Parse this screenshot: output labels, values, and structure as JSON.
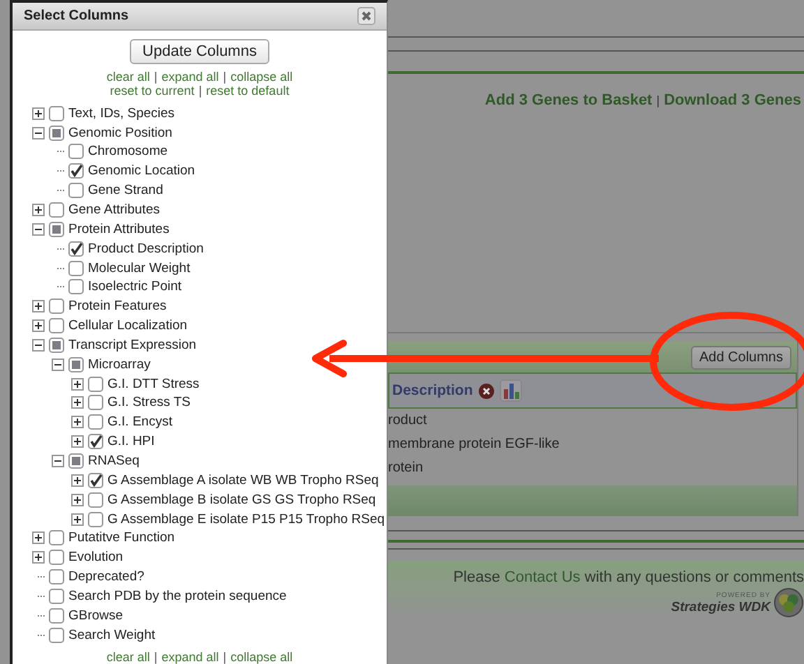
{
  "dialog": {
    "title": "Select Columns",
    "update_button": "Update Columns",
    "top_links": [
      [
        {
          "kind": "link",
          "text": "clear all"
        },
        {
          "kind": "sep",
          "text": "|"
        },
        {
          "kind": "link",
          "text": "expand all"
        },
        {
          "kind": "sep",
          "text": "|"
        },
        {
          "kind": "link",
          "text": "collapse all"
        }
      ],
      [
        {
          "kind": "link",
          "text": "reset to current"
        },
        {
          "kind": "sep",
          "text": "|"
        },
        {
          "kind": "link",
          "text": "reset to default"
        }
      ]
    ],
    "tree": [
      {
        "label": "Text, IDs, Species",
        "checked": false,
        "partial": false,
        "expanded": false
      },
      {
        "label": "Genomic Position",
        "checked": false,
        "partial": true,
        "expanded": true,
        "children": [
          {
            "label": "Chromosome",
            "checked": false,
            "partial": false
          },
          {
            "label": "Genomic Location",
            "checked": true,
            "partial": false
          },
          {
            "label": "Gene Strand",
            "checked": false,
            "partial": false
          }
        ]
      },
      {
        "label": "Gene Attributes",
        "checked": false,
        "partial": false,
        "expanded": false
      },
      {
        "label": "Protein Attributes",
        "checked": false,
        "partial": true,
        "expanded": true,
        "children": [
          {
            "label": "Product Description",
            "checked": true,
            "partial": false
          },
          {
            "label": "Molecular Weight",
            "checked": false,
            "partial": false
          },
          {
            "label": "Isoelectric Point",
            "checked": false,
            "partial": false
          }
        ]
      },
      {
        "label": "Protein Features",
        "checked": false,
        "partial": false,
        "expanded": false
      },
      {
        "label": "Cellular Localization",
        "checked": false,
        "partial": false,
        "expanded": false
      },
      {
        "label": "Transcript Expression",
        "checked": false,
        "partial": true,
        "expanded": true,
        "children": [
          {
            "label": "Microarray",
            "checked": false,
            "partial": true,
            "expanded": true,
            "children": [
              {
                "label": "G.I. DTT Stress",
                "checked": false,
                "partial": false,
                "expanded": false
              },
              {
                "label": "G.I. Stress TS",
                "checked": false,
                "partial": false,
                "expanded": false
              },
              {
                "label": "G.I. Encyst",
                "checked": false,
                "partial": false,
                "expanded": false
              },
              {
                "label": "G.I. HPI",
                "checked": true,
                "partial": false,
                "expanded": false
              }
            ]
          },
          {
            "label": "RNASeq",
            "checked": false,
            "partial": true,
            "expanded": true,
            "children": [
              {
                "label": "G Assemblage A isolate WB WB Tropho RSeq",
                "checked": true,
                "partial": false,
                "expanded": false
              },
              {
                "label": "G Assemblage B isolate GS GS Tropho RSeq",
                "checked": false,
                "partial": false,
                "expanded": false
              },
              {
                "label": "G Assemblage E isolate P15 P15 Tropho RSeq",
                "checked": false,
                "partial": false,
                "expanded": false
              }
            ]
          }
        ]
      },
      {
        "label": "Putatitve Function",
        "checked": false,
        "partial": false,
        "expanded": false
      },
      {
        "label": "Evolution",
        "checked": false,
        "partial": false,
        "expanded": false
      },
      {
        "label": "Deprecated?",
        "checked": false,
        "partial": false
      },
      {
        "label": "Search PDB by the protein sequence",
        "checked": false,
        "partial": false
      },
      {
        "label": "GBrowse",
        "checked": false,
        "partial": false
      },
      {
        "label": "Search Weight",
        "checked": false,
        "partial": false
      }
    ],
    "bottom_links": [
      {
        "kind": "link",
        "text": "clear all"
      },
      {
        "kind": "sep",
        "text": "|"
      },
      {
        "kind": "link",
        "text": "expand all"
      },
      {
        "kind": "sep",
        "text": "|"
      },
      {
        "kind": "link",
        "text": "collapse all"
      }
    ]
  },
  "page": {
    "actions": [
      {
        "kind": "link",
        "text": "Add 3 Genes to Basket"
      },
      {
        "kind": "sep",
        "text": "|"
      },
      {
        "kind": "link",
        "text": "Download 3 Genes"
      }
    ],
    "add_columns_button": "Add Columns",
    "table": {
      "column": "Description",
      "rows": [
        "roduct",
        "membrane protein EGF-like",
        "rotein"
      ]
    },
    "footer": {
      "before": "Please ",
      "link": "Contact Us",
      "after": " with any questions or comments"
    },
    "logo": {
      "small": "POWERED BY",
      "name": "Strategies WDK"
    }
  }
}
